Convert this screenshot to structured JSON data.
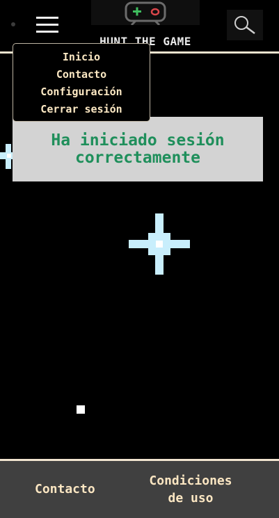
{
  "header": {
    "logo_text": "HUNT THE GAME",
    "icons": {
      "menu": "hamburger-icon",
      "logo": "gamepad-icon",
      "search": "search-icon"
    }
  },
  "menu": {
    "items": [
      {
        "label": "Inicio"
      },
      {
        "label": "Contacto"
      },
      {
        "label": "Configuración"
      },
      {
        "label": "Cerrar sesión"
      }
    ]
  },
  "banner": {
    "line1": "Ha iniciado sesión",
    "line2": "correctamente"
  },
  "footer": {
    "contact_label": "Contacto",
    "terms_line1": "Condiciones",
    "terms_line2": "de uso"
  },
  "colors": {
    "accent": "#1f8f5b",
    "cream": "#f1e4cf",
    "banner_bg": "#d3d3d3",
    "footer_bg": "#404040",
    "star": "#c8eefc"
  }
}
